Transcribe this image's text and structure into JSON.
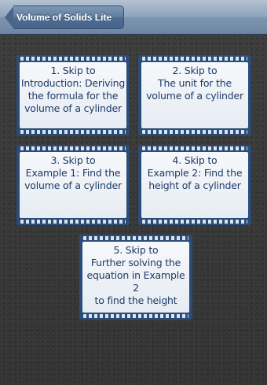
{
  "nav": {
    "back_label": "Volume of Solids Lite"
  },
  "cards": [
    {
      "text": "1. Skip to\nIntroduction: Deriving\nthe formula for the\nvolume of a cylinder"
    },
    {
      "text": "2. Skip to\nThe unit for the\nvolume of a cylinder"
    },
    {
      "text": "3. Skip to\nExample 1: Find the\nvolume of a cylinder"
    },
    {
      "text": "4. Skip to\nExample 2: Find the\nheight of a cylinder"
    },
    {
      "text": "5. Skip to\nFurther solving the\nequation in Example 2\nto find the height"
    }
  ]
}
